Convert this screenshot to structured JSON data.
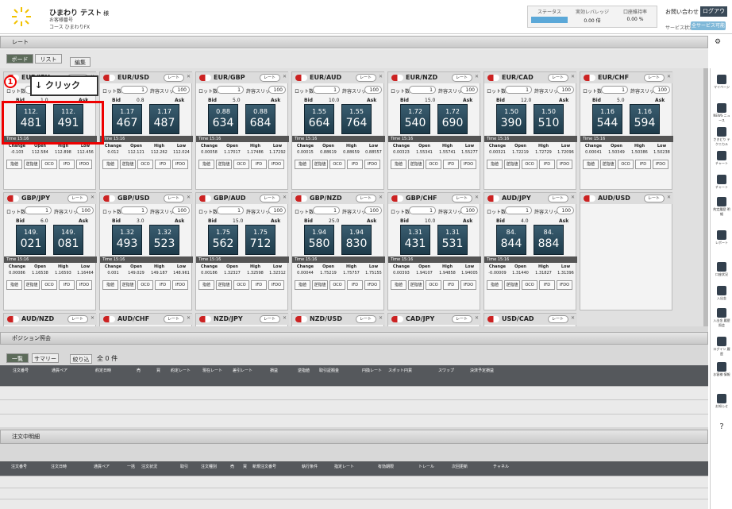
{
  "header": {
    "user_name": "ひまわり テスト",
    "sama": "様",
    "customer_no_label": "お客様番号",
    "course_label": "コース ひまわりFX",
    "status_labels": [
      "ステータス",
      "実効レバレッジ",
      "口座維持率"
    ],
    "status_values": [
      "",
      "0.00 倍",
      "0.00 %"
    ],
    "contact": "お問い合わせ",
    "logout": "ログアウト",
    "service_status": "サービス状況",
    "service_button": "全サービス可能"
  },
  "rate_section": {
    "title": "レート",
    "tabs": [
      "ボード",
      "リスト"
    ],
    "edit": "編集"
  },
  "annotation": {
    "number": "1",
    "label": "↓ クリック"
  },
  "order_buttons": [
    "指値",
    "逆指値",
    "OCO",
    "IFD",
    "IFDO"
  ],
  "panel_labels": {
    "lot": "ロット数",
    "slip": "許容スリップ",
    "lot_value": "1",
    "slip_value": "100",
    "bid": "Bid",
    "ask": "Ask",
    "rate_button": "レート",
    "time_label": "Time",
    "stat_labels": [
      "Change",
      "Open",
      "High",
      "Low"
    ]
  },
  "panels": [
    {
      "pair": "EUR/JPY",
      "spread": "1.0",
      "bid_a": "112.",
      "bid_b": "481",
      "ask_a": "112.",
      "ask_b": "491",
      "time": "15:16",
      "stats": [
        "-0.103",
        "112.584",
        "112.898",
        "112.456"
      ]
    },
    {
      "pair": "EUR/USD",
      "spread": "0.8",
      "bid_a": "1.17",
      "bid_b": "467",
      "ask_a": "1.17",
      "ask_b": "487",
      "time": "15:16",
      "stats": [
        "0.012",
        "112.121",
        "112.262",
        "112.024"
      ]
    },
    {
      "pair": "EUR/GBP",
      "spread": "5.0",
      "bid_a": "0.88",
      "bid_b": "634",
      "ask_a": "0.88",
      "ask_b": "684",
      "time": "15:16",
      "stats": [
        "0.00058",
        "1.17017",
        "1.17486",
        "1.17292"
      ]
    },
    {
      "pair": "EUR/AUD",
      "spread": "10.0",
      "bid_a": "1.55",
      "bid_b": "664",
      "ask_a": "1.55",
      "ask_b": "764",
      "time": "15:16",
      "stats": [
        "0.00015",
        "0.88619",
        "0.88659",
        "0.88557"
      ]
    },
    {
      "pair": "EUR/NZD",
      "spread": "15.0",
      "bid_a": "1.72",
      "bid_b": "540",
      "ask_a": "1.72",
      "ask_b": "690",
      "time": "15:16",
      "stats": [
        "0.00323",
        "1.55341",
        "1.55741",
        "1.55277"
      ]
    },
    {
      "pair": "EUR/CAD",
      "spread": "12.0",
      "bid_a": "1.50",
      "bid_b": "390",
      "ask_a": "1.50",
      "ask_b": "510",
      "time": "15:16",
      "stats": [
        "0.00321",
        "1.72219",
        "1.72729",
        "1.72096"
      ]
    },
    {
      "pair": "EUR/CHF",
      "spread": "5.0",
      "bid_a": "1.16",
      "bid_b": "544",
      "ask_a": "1.16",
      "ask_b": "594",
      "time": "15:16",
      "stats": [
        "0.00041",
        "1.50349",
        "1.50386",
        "1.50238"
      ]
    },
    {
      "pair": "GBP/JPY",
      "spread": "6.0",
      "bid_a": "149.",
      "bid_b": "021",
      "ask_a": "149.",
      "ask_b": "081",
      "time": "15:16",
      "stats": [
        "0.00086",
        "1.16538",
        "1.16593",
        "1.16464"
      ]
    },
    {
      "pair": "GBP/USD",
      "spread": "3.0",
      "bid_a": "1.32",
      "bid_b": "493",
      "ask_a": "1.32",
      "ask_b": "523",
      "time": "15:16",
      "stats": [
        "0.001",
        "149.029",
        "149.187",
        "148.961"
      ]
    },
    {
      "pair": "GBP/AUD",
      "spread": "15.0",
      "bid_a": "1.75",
      "bid_b": "562",
      "ask_a": "1.75",
      "ask_b": "712",
      "time": "15:16",
      "stats": [
        "0.00186",
        "1.32327",
        "1.32598",
        "1.32312"
      ]
    },
    {
      "pair": "GBP/NZD",
      "spread": "25.0",
      "bid_a": "1.94",
      "bid_b": "580",
      "ask_a": "1.94",
      "ask_b": "830",
      "time": "15:16",
      "stats": [
        "0.00044",
        "1.75219",
        "1.75757",
        "1.75155"
      ]
    },
    {
      "pair": "GBP/CHF",
      "spread": "10.0",
      "bid_a": "1.31",
      "bid_b": "431",
      "ask_a": "1.31",
      "ask_b": "531",
      "time": "15:16",
      "stats": [
        "0.00393",
        "1.94107",
        "1.94858",
        "1.94005"
      ]
    },
    {
      "pair": "AUD/JPY",
      "spread": "4.0",
      "bid_a": "84.",
      "bid_b": "844",
      "ask_a": "84.",
      "ask_b": "884",
      "time": "15:16",
      "stats": [
        "-0.00009",
        "1.31440",
        "1.31827",
        "1.31396"
      ]
    },
    {
      "pair": "AUD/USD"
    },
    {
      "pair": "AUD/NZD"
    },
    {
      "pair": "AUD/CHF"
    },
    {
      "pair": "NZD/JPY"
    },
    {
      "pair": "NZD/USD"
    },
    {
      "pair": "CAD/JPY"
    },
    {
      "pair": "USD/CAD"
    }
  ],
  "position": {
    "title": "ポジション照会",
    "tabs": [
      "一覧",
      "サマリー"
    ],
    "filter": "絞り込み",
    "count": "全 0 件",
    "columns": [
      "注文番号",
      "通貨ペア",
      "約定日時",
      "売",
      "買",
      "約定レート",
      "現在レート",
      "差引レート",
      "損益",
      "逆指値",
      "取引証拠金",
      "円換レート",
      "スポット円貨",
      "スワップ",
      "決済予定損益"
    ]
  },
  "orders": {
    "title": "注文中明細",
    "columns": [
      "注文番号",
      "注文日時",
      "通貨ペア",
      "一括",
      "注文状況",
      "取引",
      "注文種別",
      "売",
      "買",
      "新規注文番号",
      "執行条件",
      "指定レート",
      "有効期限",
      "トレール",
      "次回更新",
      "チャネル"
    ]
  },
  "sidebar": [
    {
      "label": "マイページ"
    },
    {
      "label": "NEWS ニュース"
    },
    {
      "label": "さきどり テクニカル"
    },
    {
      "label": "チャート"
    },
    {
      "label": "チャート"
    },
    {
      "label": "約定履歴 明細"
    },
    {
      "label": "レポート"
    },
    {
      "label": "口座状況"
    },
    {
      "label": "入出金"
    },
    {
      "label": "入出金 履歴照会"
    },
    {
      "label": "ログイン 履歴"
    },
    {
      "label": "お客様 情報"
    },
    {
      "label": "お知らせ"
    }
  ]
}
